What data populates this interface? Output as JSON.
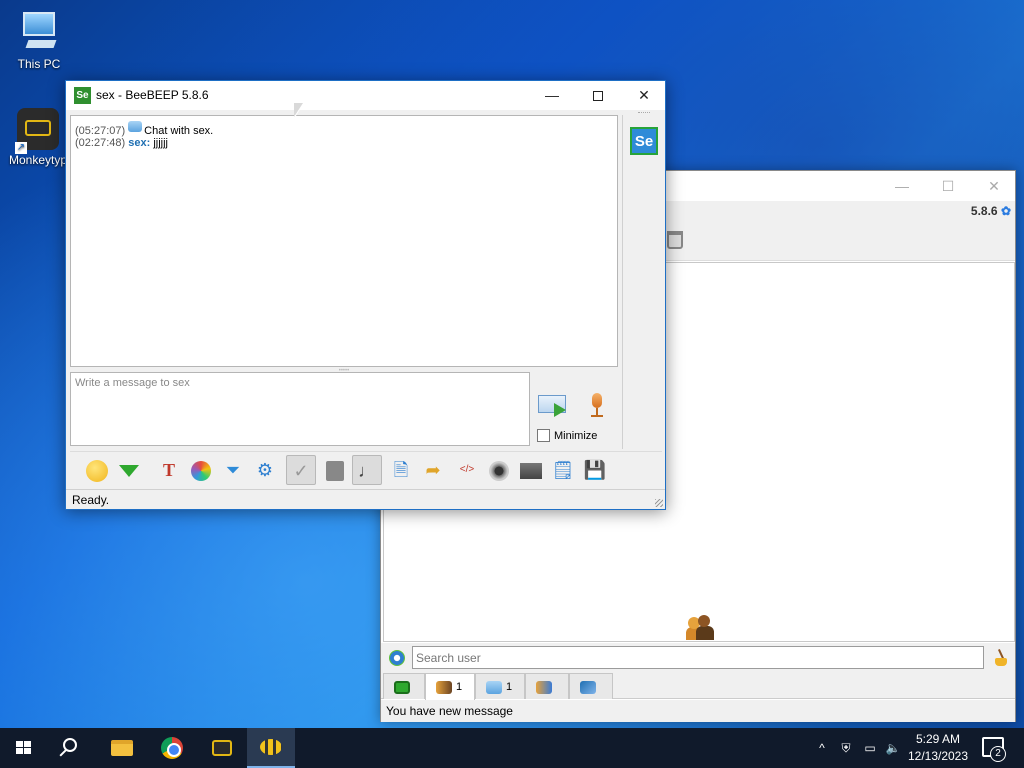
{
  "desktop": {
    "icons": [
      {
        "label": "This PC"
      },
      {
        "label": "Monkeytyp"
      }
    ]
  },
  "main_window": {
    "version": "5.8.6",
    "search": {
      "placeholder": "Search user",
      "value": ""
    },
    "tabs": [
      {
        "count": "1"
      },
      {
        "count": "1"
      }
    ],
    "status": "You have new message"
  },
  "chat_window": {
    "title": "sex - BeeBEEP 5.8.6",
    "app_icon_text": "Se",
    "avatar_text": "Se",
    "messages": [
      {
        "time": "(05:27:07)",
        "text": "Chat with sex."
      },
      {
        "time": "(02:27:48)",
        "user": "sex:",
        "text": "jjjjjj"
      }
    ],
    "input": {
      "placeholder": "Write a message to sex",
      "value": ""
    },
    "minimize_label": "Minimize",
    "status": "Ready."
  },
  "taskbar": {
    "clock_time": "5:29 AM",
    "clock_date": "12/13/2023",
    "notification_count": "2"
  }
}
